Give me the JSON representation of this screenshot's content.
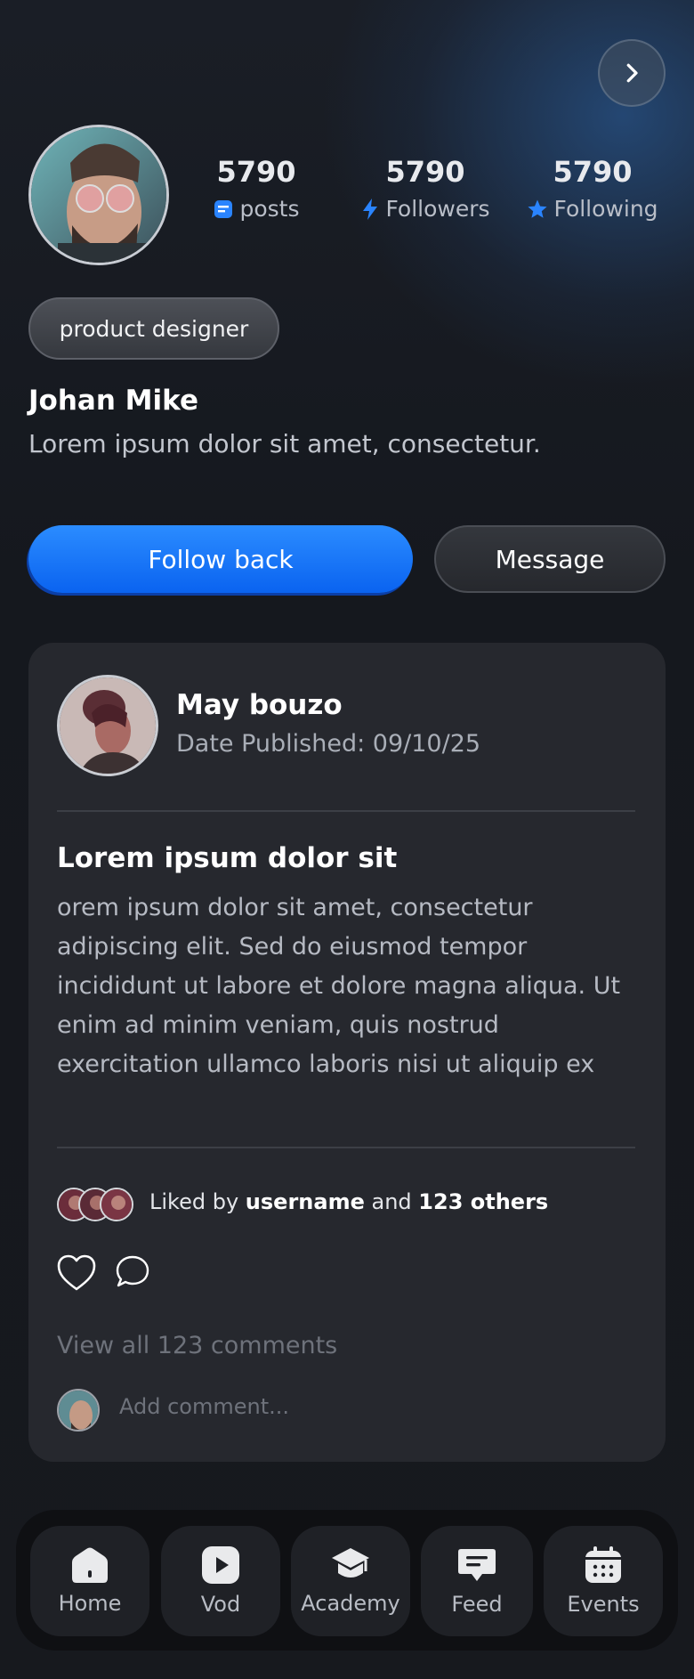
{
  "profile": {
    "name": "Johan Mike",
    "bio": "Lorem ipsum dolor sit amet, consectetur.",
    "role": "product designer",
    "stats": [
      {
        "value": "5790",
        "label": "posts",
        "icon": "posts-icon",
        "icon_color": "#2a84ff"
      },
      {
        "value": "5790",
        "label": "Followers",
        "icon": "lightning-icon",
        "icon_color": "#2a84ff"
      },
      {
        "value": "5790",
        "label": "Following",
        "icon": "star-icon",
        "icon_color": "#2a84ff"
      }
    ]
  },
  "actions": {
    "follow_label": "Follow back",
    "message_label": "Message"
  },
  "post": {
    "author": "May bouzo",
    "date": "Date Published: 09/10/25",
    "title": "Lorem ipsum dolor sit",
    "body": "orem ipsum dolor sit amet, consectetur adipiscing elit. Sed do eiusmod tempor incididunt ut labore et dolore magna aliqua. Ut enim ad minim veniam, quis nostrud exercitation ullamco laboris nisi ut aliquip ex",
    "liked_prefix": "Liked by",
    "liked_user": "username",
    "liked_and": "and",
    "liked_others": "123 others",
    "view_comments": "View all 123 comments",
    "comment_placeholder": "Add comment..."
  },
  "tabs": [
    {
      "label": "Home",
      "icon": "home-icon"
    },
    {
      "label": "Vod",
      "icon": "play-icon"
    },
    {
      "label": "Academy",
      "icon": "graduation-cap-icon"
    },
    {
      "label": "Feed",
      "icon": "chat-bubble-icon"
    },
    {
      "label": "Events",
      "icon": "calendar-icon"
    }
  ],
  "colors": {
    "accent": "#1a78ff",
    "background": "#16191f",
    "card": "#26282e"
  }
}
